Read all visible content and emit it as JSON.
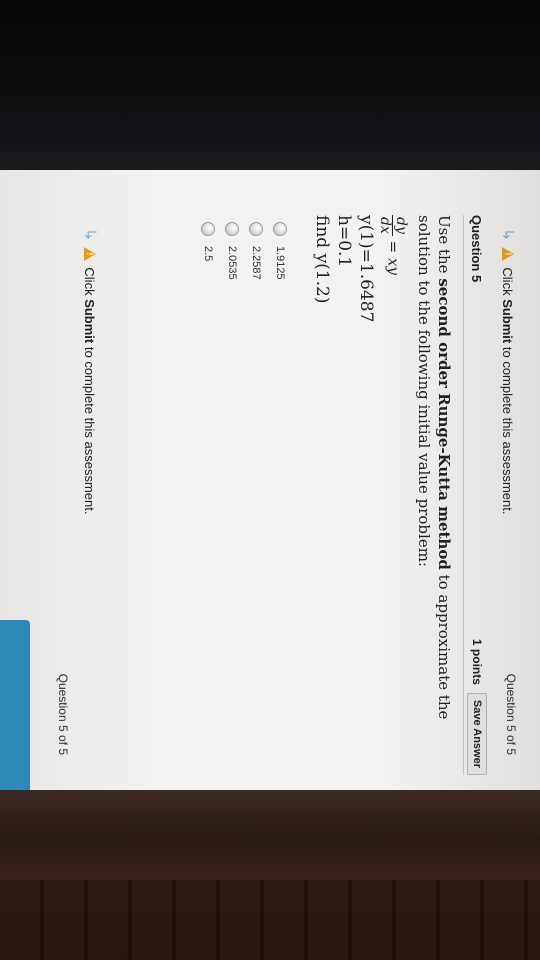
{
  "hint_top": {
    "prefix": "Click ",
    "strong": "Submit",
    "suffix": " to complete this assessment."
  },
  "question_position_top": "Question 5 of 5",
  "question": {
    "title": "Question 5",
    "points": "1 points",
    "save_label": "Save Answer",
    "text_prefix": "Use the ",
    "text_strong": "second order Runge-Kutta method",
    "text_suffix": " to approximate the solution to the following initial value problem:",
    "frac_num": "dy",
    "frac_den": "dx",
    "eq_rhs": " = xy",
    "initial": "y(1)=1.6487",
    "step": "h=0.1",
    "find": "find y(1.2)"
  },
  "options": [
    "1.9125",
    "2.2587",
    "2.0535",
    "2.5"
  ],
  "hint_bottom": {
    "prefix": "Click ",
    "strong": "Submit",
    "suffix": " to complete this assessment."
  },
  "question_position_bottom": "Question 5 of 5",
  "colors": {
    "warning": "#e8a126",
    "submit": "#2f8fc1",
    "arrow": "#8fb3cf"
  }
}
